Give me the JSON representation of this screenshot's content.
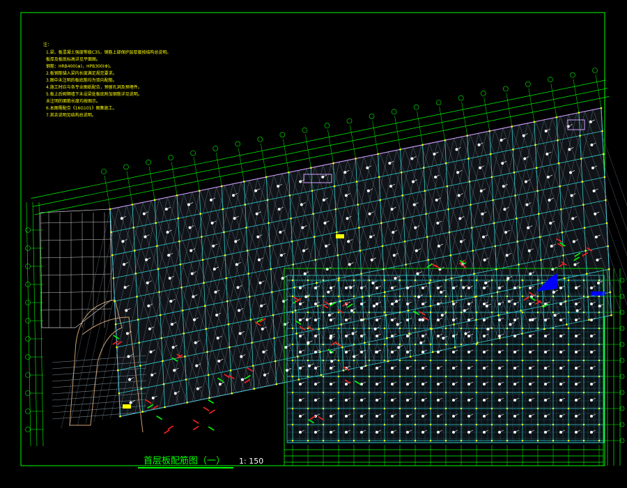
{
  "drawing": {
    "title": "首层板配筋图（一）",
    "scale": "1: 150",
    "colors": {
      "background": "#000000",
      "frame": "#00ff00",
      "grid": "#2fd0d0",
      "mesh": "#9ab0c8",
      "boundary": "#d0a0ff",
      "notes": "#ffff00",
      "rebar_red": "#ff2020",
      "rebar_green": "#00ff00",
      "marker": "#ffff00",
      "tag": "#ffffff",
      "highlight": "#0000ff"
    }
  },
  "notes": {
    "heading": "注：",
    "lines": [
      "1.梁、板混凝土强度等级C35，钢筋上部保护层厚度按结构总说明。",
      "  板厚及板底标高详见平面图。",
      "  钢筋：HRB400(⊕)，HPB300(Φ)。",
      "2.板钢筋锚入梁内长度满足规范要求。",
      "3.图中未注明的板底筋均为双向配筋。",
      "4.施工时应与各专业图纸配合，预留孔洞及预埋件。",
      "5.板上后砌隔墙下未设梁处板底附加钢筋详见说明。",
      "  未注明的面筋长度均按图示。",
      "6.本图需配合《16G101》图集施工。",
      "7.其余说明见结构总说明。"
    ]
  }
}
